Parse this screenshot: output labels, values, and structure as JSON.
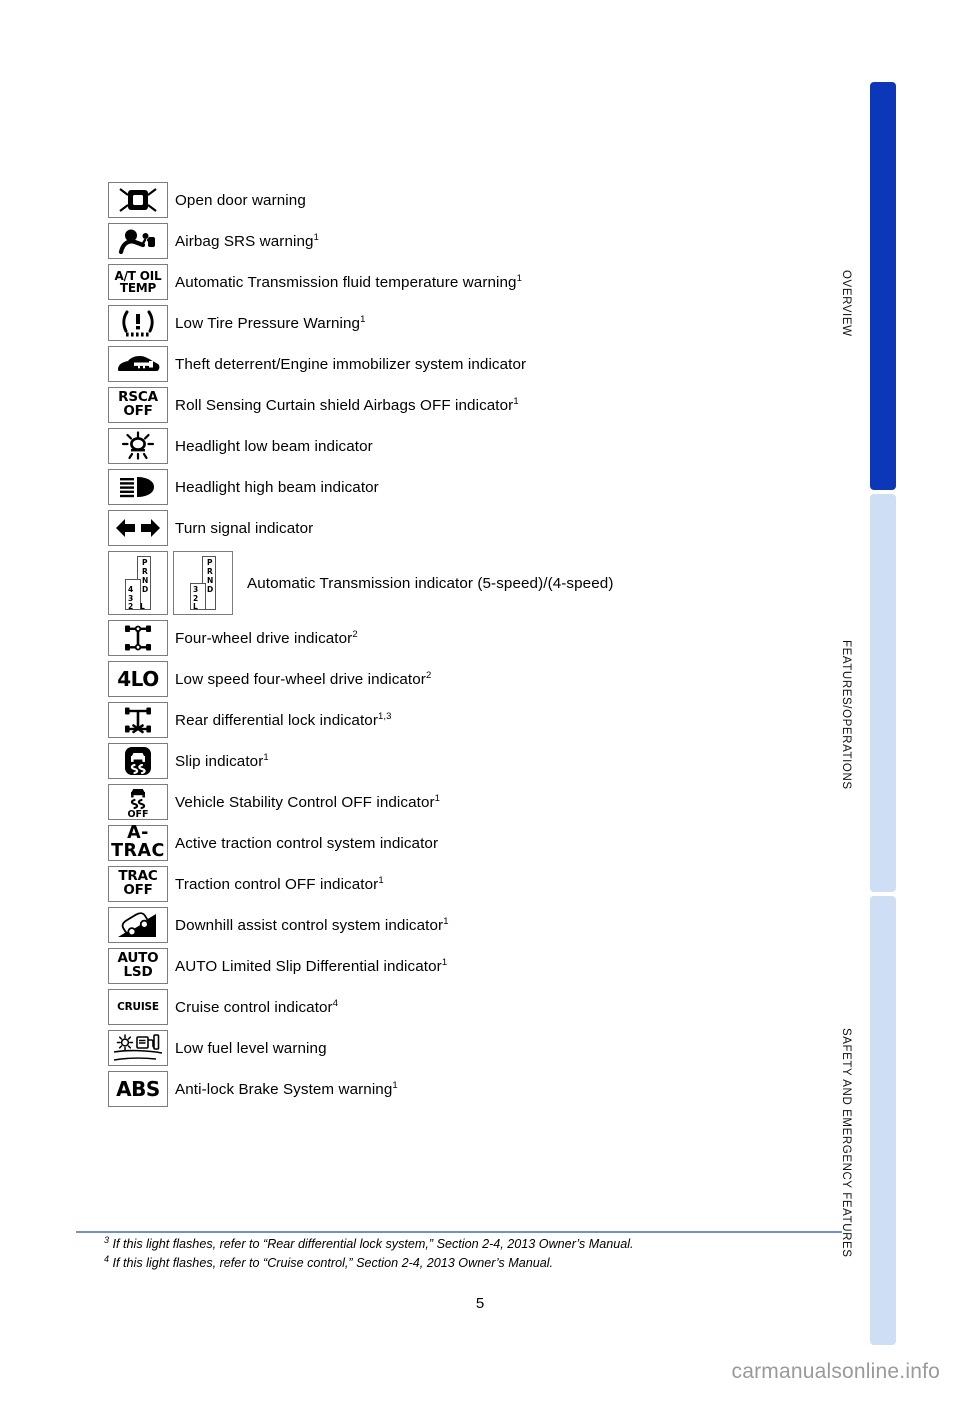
{
  "document": {
    "page_number": "5",
    "watermark": "carmanualsonline.info"
  },
  "side_tabs": [
    {
      "label": "OVERVIEW",
      "color": "#0b37b8",
      "active": true
    },
    {
      "label": "FEATURES/OPERATIONS",
      "color": "#cedef5",
      "active": false
    },
    {
      "label": "SAFETY AND EMERGENCY FEATURES",
      "color": "#cedef5",
      "active": false
    }
  ],
  "indicator_rows": [
    {
      "icon": "open-door-warning-icon",
      "icon_kind": "glyph",
      "description": "Open door warning",
      "footnote": ""
    },
    {
      "icon": "airbag-srs-warning-icon",
      "icon_kind": "glyph",
      "description": "Airbag SRS warning",
      "footnote": "1"
    },
    {
      "icon": "at-oil-temp-icon",
      "icon_kind": "text",
      "icon_text": [
        "A/T OIL",
        "TEMP"
      ],
      "description": "Automatic Transmission fluid temperature warning",
      "footnote": "1"
    },
    {
      "icon": "low-tire-pressure-warning-icon",
      "icon_kind": "glyph",
      "description": "Low Tire Pressure Warning",
      "footnote": "1"
    },
    {
      "icon": "theft-deterrent-icon",
      "icon_kind": "glyph",
      "description": "Theft deterrent/Engine immobilizer system indicator",
      "footnote": ""
    },
    {
      "icon": "rsca-off-icon",
      "icon_kind": "text",
      "icon_text": [
        "RSCA",
        "OFF"
      ],
      "description": "Roll Sensing Curtain shield Airbags OFF indicator",
      "footnote": "1"
    },
    {
      "icon": "headlight-low-beam-icon",
      "icon_kind": "glyph",
      "description": "Headlight low beam indicator",
      "footnote": ""
    },
    {
      "icon": "headlight-high-beam-icon",
      "icon_kind": "glyph",
      "description": "Headlight high beam indicator",
      "footnote": ""
    },
    {
      "icon": "turn-signal-icon",
      "icon_kind": "glyph",
      "description": "Turn signal indicator",
      "footnote": ""
    },
    {
      "icon": "automatic-transmission-indicator-icon",
      "icon_kind": "shift-pair",
      "description": "Automatic Transmission indicator (5-speed)/(4-speed)",
      "footnote": ""
    },
    {
      "icon": "four-wheel-drive-icon",
      "icon_kind": "glyph",
      "description": "Four-wheel drive indicator",
      "footnote": "2"
    },
    {
      "icon": "four-lo-icon",
      "icon_kind": "text",
      "icon_text": [
        "4LO"
      ],
      "description": "Low speed four-wheel drive indicator",
      "footnote": "2"
    },
    {
      "icon": "rear-differential-lock-icon",
      "icon_kind": "glyph",
      "description": "Rear differential lock indicator",
      "footnote": "1,3"
    },
    {
      "icon": "slip-indicator-icon",
      "icon_kind": "glyph",
      "description": "Slip indicator",
      "footnote": "1"
    },
    {
      "icon": "vsc-off-icon",
      "icon_kind": "glyph",
      "description": "Vehicle Stability Control OFF indicator",
      "footnote": "1"
    },
    {
      "icon": "a-trac-icon",
      "icon_kind": "text",
      "icon_text": [
        "A-TRAC"
      ],
      "description": "Active traction control system indicator",
      "footnote": ""
    },
    {
      "icon": "trac-off-icon",
      "icon_kind": "text",
      "icon_text": [
        "TRAC",
        "OFF"
      ],
      "description": "Traction control OFF indicator",
      "footnote": "1"
    },
    {
      "icon": "downhill-assist-control-icon",
      "icon_kind": "glyph",
      "description": "Downhill assist control system indicator",
      "footnote": "1"
    },
    {
      "icon": "auto-lsd-icon",
      "icon_kind": "text",
      "icon_text": [
        "AUTO",
        "LSD"
      ],
      "description": "AUTO Limited Slip Differential indicator",
      "footnote": "1"
    },
    {
      "icon": "cruise-icon",
      "icon_kind": "text",
      "icon_text": [
        "CRUISE"
      ],
      "description": "Cruise control indicator",
      "footnote": "4"
    },
    {
      "icon": "low-fuel-level-warning-icon",
      "icon_kind": "glyph",
      "description": "Low fuel level warning",
      "footnote": ""
    },
    {
      "icon": "abs-icon",
      "icon_kind": "text",
      "icon_text": [
        "ABS"
      ],
      "description": "Anti-lock Brake System warning",
      "footnote": "1"
    }
  ],
  "shift_patterns": {
    "five_speed": [
      "P",
      "R",
      "N",
      "D",
      "4",
      "3",
      "2",
      "L"
    ],
    "four_speed": [
      "P",
      "R",
      "N",
      "D",
      "3",
      "2",
      "L"
    ]
  },
  "footnotes": [
    {
      "marker": "3",
      "text": "If this light flashes, refer to “Rear differential lock system,” Section 2-4, 2013 Owner’s Manual."
    },
    {
      "marker": "4",
      "text": "If this light flashes, refer to “Cruise control,” Section 2-4, 2013 Owner’s Manual."
    }
  ]
}
